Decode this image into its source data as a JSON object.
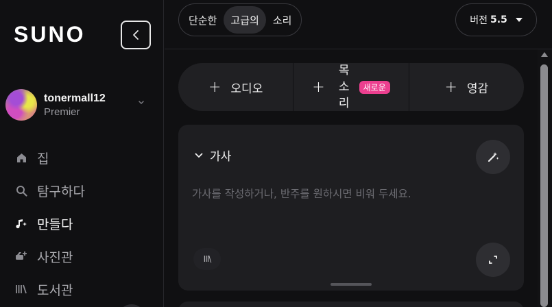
{
  "app": {
    "logo": "SUNO"
  },
  "sidebar": {
    "profile": {
      "username": "tonermall12",
      "plan": "Premier"
    },
    "items": [
      {
        "label": "집",
        "icon": "home-icon"
      },
      {
        "label": "탐구하다",
        "icon": "search-icon"
      },
      {
        "label": "만들다",
        "icon": "music-sparkle-icon",
        "active": true
      },
      {
        "label": "사진관",
        "icon": "studio-icon"
      },
      {
        "label": "도서관",
        "icon": "library-icon"
      }
    ]
  },
  "topbar": {
    "modes": [
      "단순한",
      "고급의",
      "소리"
    ],
    "active_mode": "고급의",
    "version_label": "버전",
    "version_number": "5.5"
  },
  "add_row": {
    "audio_label": "오디오",
    "voice_label": "목소리",
    "voice_badge": "새로운",
    "inspiration_label": "영감"
  },
  "lyrics": {
    "title": "가사",
    "placeholder": "가사를 작성하거나, 반주를 원하시면 비워 두세요.",
    "library_icon_text": "III\\"
  },
  "colors": {
    "accent_badge": "#ec3f8f",
    "background": "#101012",
    "card": "#1e1e21"
  }
}
